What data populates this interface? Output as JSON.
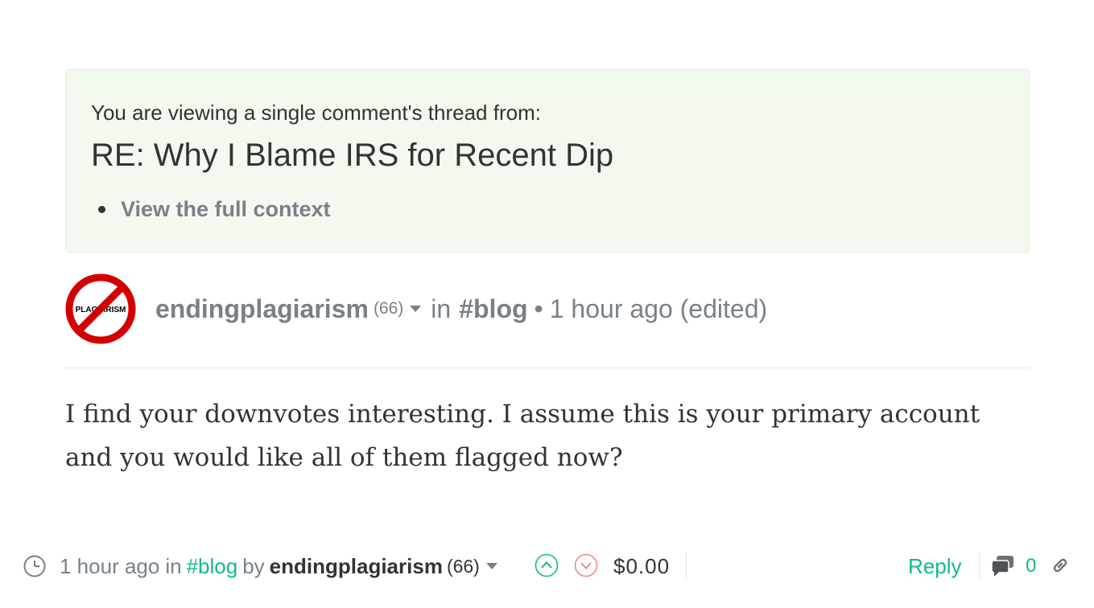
{
  "context": {
    "intro": "You are viewing a single comment's thread from:",
    "title": "RE: Why I Blame IRS for Recent Dip",
    "link_label": "View the full context"
  },
  "post": {
    "avatar_text": "PLAGIARISM",
    "author": "endingplagiarism",
    "reputation": "(66)",
    "in_label": "in",
    "tag": "#blog",
    "separator": "•",
    "time": "1 hour ago (edited)",
    "body": "I find your downvotes interesting. I assume this is your primary account and you would like all of them flagged now?"
  },
  "footer": {
    "time": "1 hour ago",
    "in_label": "in",
    "tag": "#blog",
    "by_label": "by",
    "author": "endingplagiarism",
    "reputation": "(66)",
    "payout": "$0.00",
    "reply_label": "Reply",
    "comment_count": "0"
  },
  "colors": {
    "accent": "#12b98a",
    "muted": "#788187",
    "downvote": "#e88b8b",
    "context_bg": "#f2f9ef"
  },
  "icons": [
    "clock-icon",
    "upvote-icon",
    "downvote-icon",
    "comments-icon",
    "link-icon",
    "caret-down-icon"
  ]
}
